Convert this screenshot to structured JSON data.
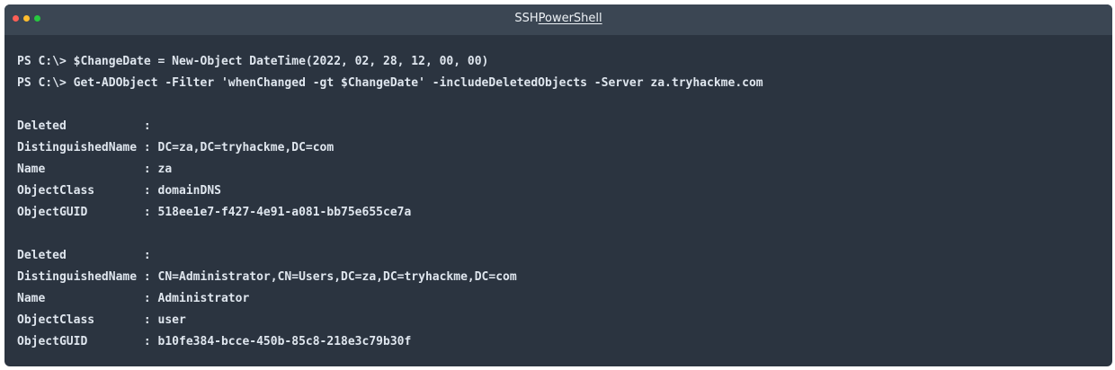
{
  "window": {
    "title_prefix": "SSH",
    "title_main": "PowerShell"
  },
  "terminal": {
    "lines": [
      "PS C:\\> $ChangeDate = New-Object DateTime(2022, 02, 28, 12, 00, 00)",
      "PS C:\\> Get-ADObject -Filter 'whenChanged -gt $ChangeDate' -includeDeletedObjects -Server za.tryhackme.com",
      "",
      "Deleted           :",
      "DistinguishedName : DC=za,DC=tryhackme,DC=com",
      "Name              : za",
      "ObjectClass       : domainDNS",
      "ObjectGUID        : 518ee1e7-f427-4e91-a081-bb75e655ce7a",
      "",
      "Deleted           :",
      "DistinguishedName : CN=Administrator,CN=Users,DC=za,DC=tryhackme,DC=com",
      "Name              : Administrator",
      "ObjectClass       : user",
      "ObjectGUID        : b10fe384-bcce-450b-85c8-218e3c79b30f"
    ]
  }
}
